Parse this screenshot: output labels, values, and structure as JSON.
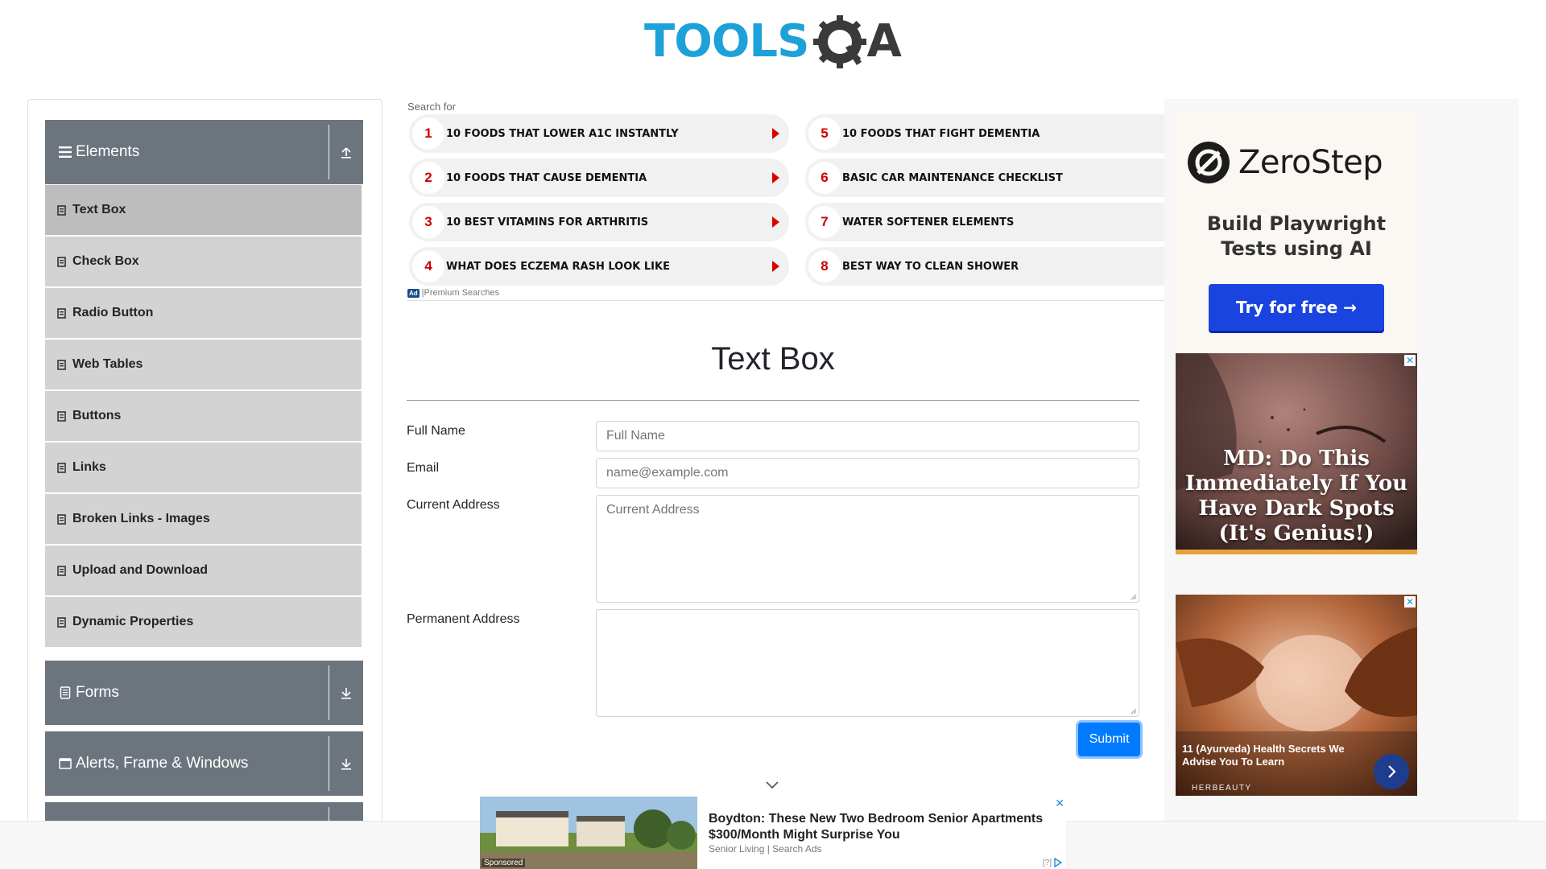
{
  "header": {
    "logo_text": "TOOLS",
    "logo_suffix": "A"
  },
  "sidebar": {
    "elements_group": {
      "title": "Elements"
    },
    "items": [
      {
        "label": "Text Box"
      },
      {
        "label": "Check Box"
      },
      {
        "label": "Radio Button"
      },
      {
        "label": "Web Tables"
      },
      {
        "label": "Buttons"
      },
      {
        "label": "Links"
      },
      {
        "label": "Broken Links - Images"
      },
      {
        "label": "Upload and Download"
      },
      {
        "label": "Dynamic Properties"
      }
    ],
    "forms_group": {
      "title": "Forms"
    },
    "alerts_group": {
      "title": "Alerts, Frame & Windows"
    }
  },
  "search_ad": {
    "heading": "Search for",
    "items": [
      {
        "num": "1",
        "text": "10 FOODS THAT LOWER A1C INSTANTLY"
      },
      {
        "num": "2",
        "text": "10 FOODS THAT CAUSE DEMENTIA"
      },
      {
        "num": "3",
        "text": "10 BEST VITAMINS FOR ARTHRITIS"
      },
      {
        "num": "4",
        "text": "WHAT DOES ECZEMA RASH LOOK LIKE"
      },
      {
        "num": "5",
        "text": "10 FOODS THAT FIGHT DEMENTIA"
      },
      {
        "num": "6",
        "text": "BASIC CAR MAINTENANCE CHECKLIST"
      },
      {
        "num": "7",
        "text": "WATER SOFTENER ELEMENTS"
      },
      {
        "num": "8",
        "text": "BEST WAY TO CLEAN SHOWER"
      }
    ],
    "badge": "Ad",
    "footer": "Premium Searches"
  },
  "main": {
    "title": "Text Box",
    "full_name_label": "Full Name",
    "full_name_placeholder": "Full Name",
    "email_label": "Email",
    "email_placeholder": "name@example.com",
    "current_address_label": "Current Address",
    "current_address_placeholder": "Current Address",
    "permanent_address_label": "Permanent Address",
    "submit_label": "Submit"
  },
  "right_ads": {
    "zerostep": {
      "brand": "ZeroStep",
      "tagline": "Build Playwright Tests using AI",
      "cta": "Try for free →"
    },
    "ad2": {
      "headline": "MD: Do This Immediately If You Have Dark Spots (It's Genius!)"
    },
    "ad3": {
      "headline": "11 (Ayurveda) Health Secrets We Advise You To Learn",
      "brand": "HERBEAUTY"
    }
  },
  "bottom_ad": {
    "sponsored": "Sponsored",
    "title": "Boydton: These New Two Bedroom Senior Apartments $300/Month Might Surprise You",
    "source": "Senior Living | Search Ads",
    "info": "[?]"
  },
  "colors": {
    "brand_blue": "#1da1d8",
    "sidebar_header": "#6c757d",
    "menu_item": "#d3d3d3",
    "submit": "#007bff"
  }
}
